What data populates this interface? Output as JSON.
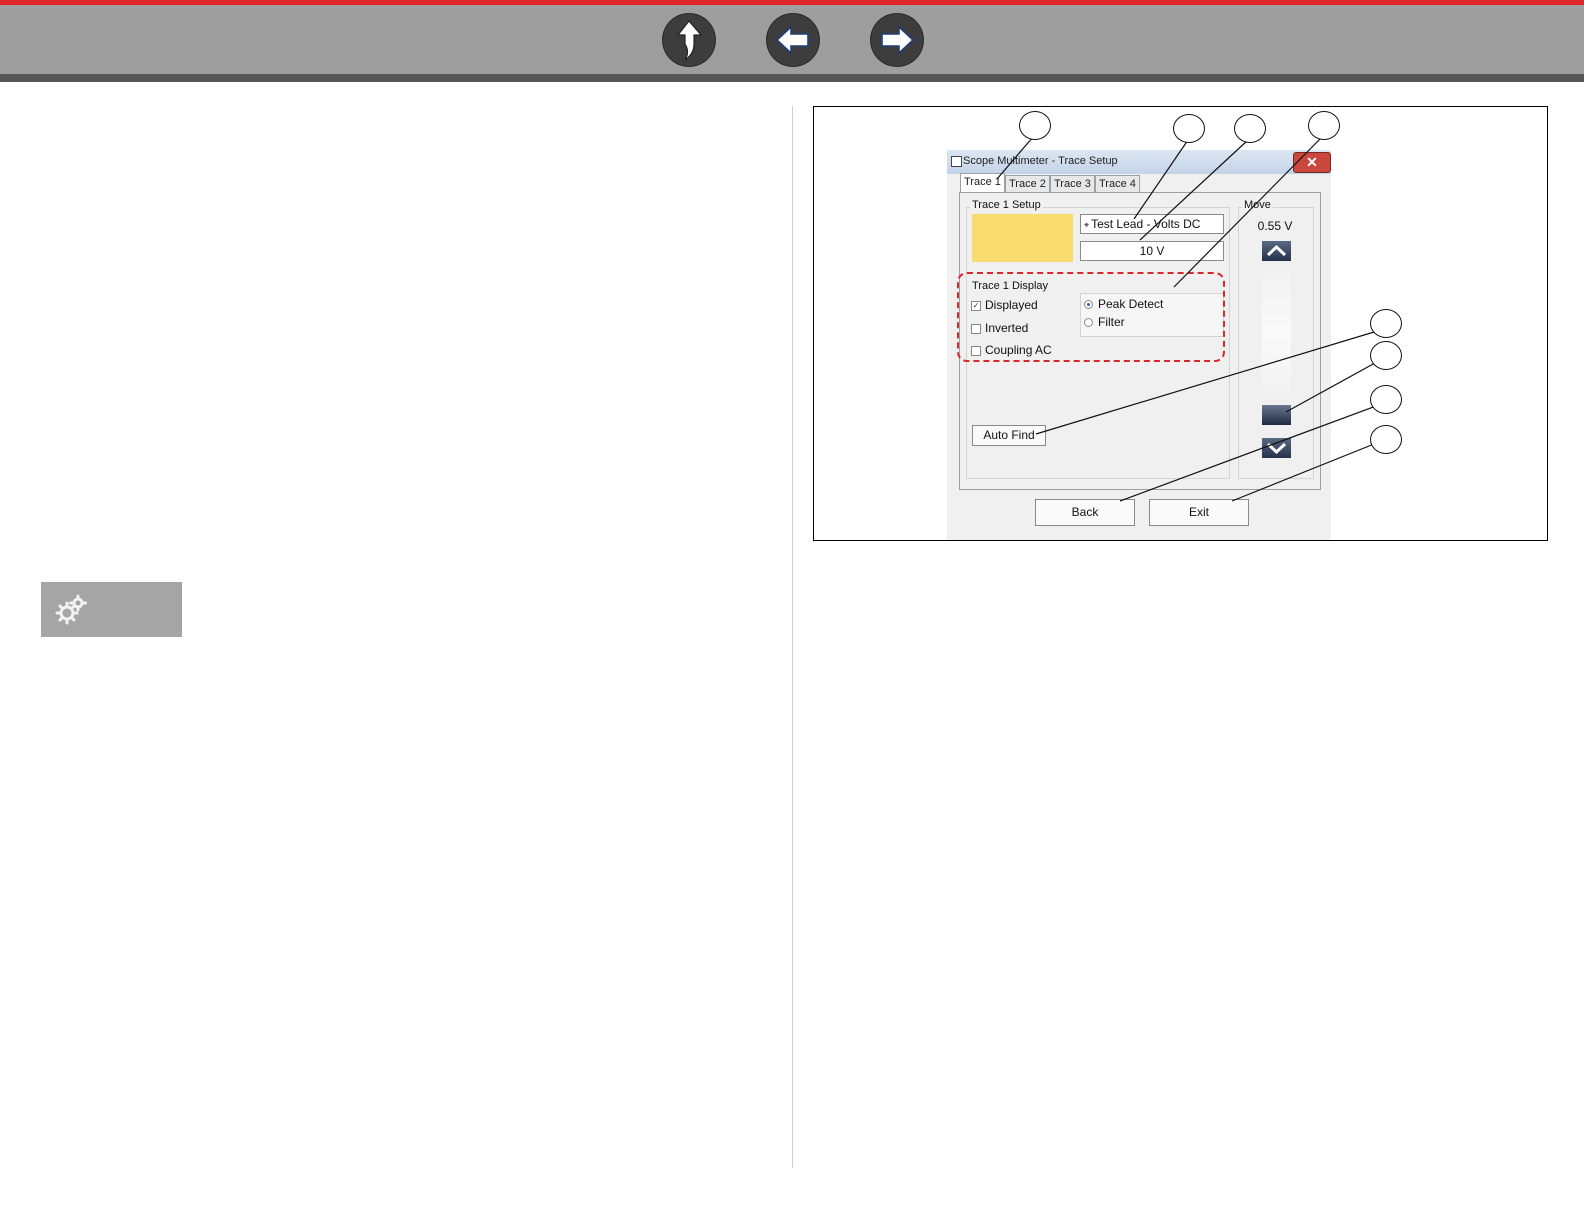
{
  "dialog": {
    "title": "Scope Multimeter - Trace Setup",
    "tabs": [
      "Trace 1",
      "Trace 2",
      "Trace 3",
      "Trace 4"
    ],
    "setup_group_label": "Trace 1 Setup",
    "input_source": "Test Lead - Volts DC",
    "scale": "10 V",
    "display_group_label": "Trace 1 Display",
    "checkboxes": [
      {
        "label": "Displayed",
        "checked": true
      },
      {
        "label": "Inverted",
        "checked": false
      },
      {
        "label": "Coupling AC",
        "checked": false
      }
    ],
    "radios": [
      {
        "label": "Peak Detect",
        "selected": true
      },
      {
        "label": "Filter",
        "selected": false
      }
    ],
    "auto_find_label": "Auto Find",
    "move_label": "Move",
    "move_value": "0.55 V",
    "back_label": "Back",
    "exit_label": "Exit",
    "close_glyph": "✕"
  },
  "colors": {
    "top_accent": "#e0262b",
    "toolbar": "#9e9e9e",
    "trace_swatch": "#f8dc70",
    "highlight_dash": "#d8282b"
  },
  "icons": {
    "nav": [
      "home-up-arrow-icon",
      "back-arrow-icon",
      "forward-arrow-icon"
    ],
    "settings": "gears-icon"
  }
}
